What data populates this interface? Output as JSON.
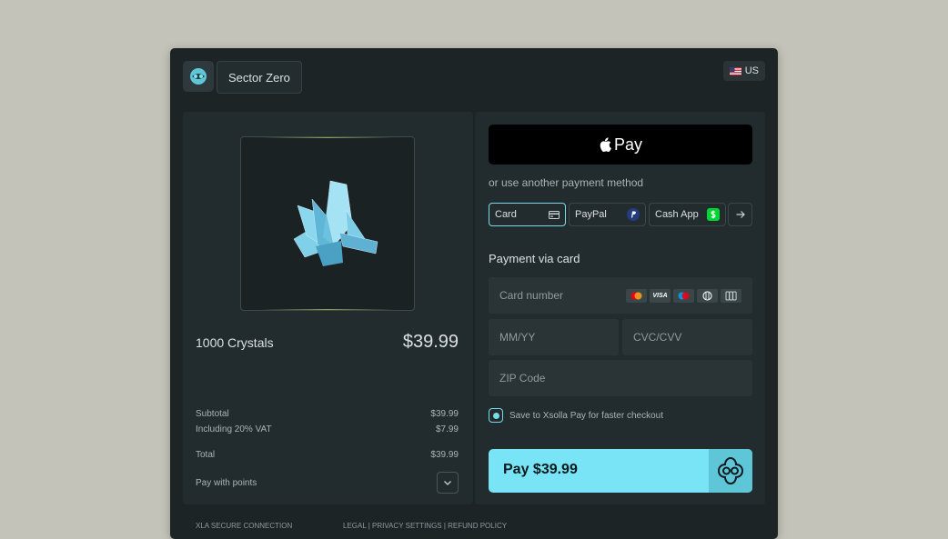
{
  "brand": {
    "name": "Sector Zero"
  },
  "locale": {
    "label": "US"
  },
  "product": {
    "name": "1000 Crystals",
    "price": "$39.99"
  },
  "summary": {
    "subtotal_label": "Subtotal",
    "subtotal_value": "$39.99",
    "vat_label": "Including 20% VAT",
    "vat_value": "$7.99",
    "total_label": "Total",
    "total_value": "$39.99",
    "points_label": "Pay with points"
  },
  "payment": {
    "apple_pay_label": "Pay",
    "other_methods_label": "or use another payment method",
    "methods": [
      {
        "label": "Card",
        "active": true
      },
      {
        "label": "PayPal"
      },
      {
        "label": "Cash App"
      }
    ],
    "card_section_title": "Payment via card",
    "card_number_placeholder": "Card number",
    "expiry_placeholder": "MM/YY",
    "cvc_placeholder": "CVC/CVV",
    "zip_placeholder": "ZIP Code",
    "card_brands": [
      "Mastercard",
      "VISA",
      "Maestro",
      "Diners",
      "JCB"
    ],
    "visa_text": "VISA",
    "save_label": "Save to Xsolla Pay for faster checkout",
    "pay_button_label": "Pay $39.99"
  },
  "footer": {
    "secure": "XLA SECURE CONNECTION",
    "links": "LEGAL | PRIVACY SETTINGS | REFUND POLICY"
  },
  "colors": {
    "accent": "#79e4f6",
    "background": "#c3c3b9",
    "window": "#1c2426",
    "panel": "#222c2e"
  }
}
